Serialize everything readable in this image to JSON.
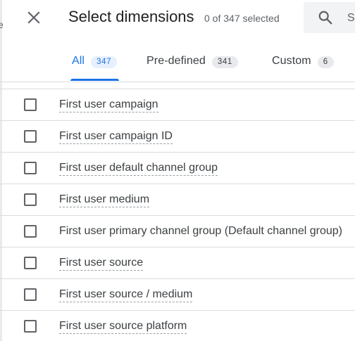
{
  "background_peek": "e",
  "header": {
    "close_icon": "close-icon",
    "title": "Select dimensions",
    "selection_count": "0 of 347 selected",
    "search_icon": "search-icon",
    "search_placeholder": "S"
  },
  "tabs": [
    {
      "label": "All",
      "count": "347",
      "active": true
    },
    {
      "label": "Pre-defined",
      "count": "341",
      "active": false
    },
    {
      "label": "Custom",
      "count": "6",
      "active": false
    }
  ],
  "dimensions": [
    {
      "label": "First user campaign",
      "checked": false
    },
    {
      "label": "First user campaign ID",
      "checked": false
    },
    {
      "label": "First user default channel group",
      "checked": false
    },
    {
      "label": "First user medium",
      "checked": false
    },
    {
      "label": "First user primary channel group (Default channel group)",
      "checked": false
    },
    {
      "label": "First user source",
      "checked": false
    },
    {
      "label": "First user source / medium",
      "checked": false
    },
    {
      "label": "First user source platform",
      "checked": false
    }
  ],
  "colors": {
    "accent": "#1a73e8",
    "text": "#202124",
    "muted": "#5f6368",
    "divider": "#dadce0"
  }
}
